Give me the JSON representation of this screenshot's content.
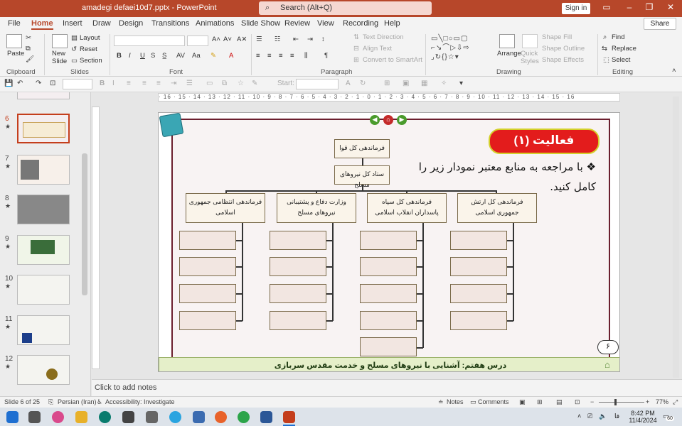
{
  "window": {
    "title": "amadegi defaei10d7.pptx  -  PowerPoint",
    "search_placeholder": "Search (Alt+Q)",
    "signin": "Sign in"
  },
  "menu": {
    "tabs": [
      "File",
      "Home",
      "Insert",
      "Draw",
      "Design",
      "Transitions",
      "Animations",
      "Slide Show",
      "Review",
      "View",
      "Recording",
      "Help"
    ],
    "active": "Home",
    "share": "Share"
  },
  "ribbon": {
    "clipboard": {
      "paste": "Paste",
      "group": "Clipboard"
    },
    "slides": {
      "new_slide": "New Slide",
      "layout": "Layout",
      "reset": "Reset",
      "section": "Section",
      "group": "Slides"
    },
    "font": {
      "group": "Font",
      "bold": "B",
      "italic": "I",
      "underline": "U",
      "strike": "S"
    },
    "paragraph": {
      "text_direction": "Text Direction",
      "align_text": "Align Text",
      "convert": "Convert to SmartArt",
      "group": "Paragraph"
    },
    "drawing": {
      "arrange": "Arrange",
      "quick_styles": "Quick Styles",
      "shape_fill": "Shape Fill",
      "shape_outline": "Shape Outline",
      "shape_effects": "Shape Effects",
      "group": "Drawing"
    },
    "editing": {
      "find": "Find",
      "replace": "Replace",
      "select": "Select",
      "group": "Editing"
    }
  },
  "qat": {
    "start_label": "Start:"
  },
  "thumbnails": [
    {
      "num": "6",
      "selected": true
    },
    {
      "num": "7",
      "selected": false
    },
    {
      "num": "8",
      "selected": false
    },
    {
      "num": "9",
      "selected": false
    },
    {
      "num": "10",
      "selected": false
    },
    {
      "num": "11",
      "selected": false
    },
    {
      "num": "12",
      "selected": false
    }
  ],
  "ruler": {
    "h_ticks": "· 16 · 15 · 14 · 13 · 12 · 11 · 10 · 9 · 8 · 7 · 6 · 5 · 4 · 3 · 2 · 1 · 0 · 1 · 2 · 3 · 4 · 5 · 6 · 7 · 8 · 9 · 10 · 11 · 12 · 13 · 14 · 15 · 16"
  },
  "slide": {
    "activity_title": "فعالیت (۱)",
    "instruction": "❖ با مراجعه به منابع معتبر نمودار زیر را کامل کنید.",
    "top_box": "فرماندهی کل قوا",
    "staff_box": "ستاد کل نیروهای مسلح",
    "branches": [
      "فرماندهی کل ارتش جمهوری اسلامی",
      "فرماندهی کل سپاه پاسداران انقلاب اسلامی",
      "وزارت دفاع و پشتیبانی نیروهای مسلح",
      "فرماندهی انتظامی جمهوری اسلامی"
    ],
    "footer": "درس هفتم: آشنایی با نیروهای مسلح و خدمت مقدس سربازی",
    "page": "۶"
  },
  "notes": {
    "placeholder": "Click to add notes"
  },
  "status": {
    "slide": "Slide 6 of 25",
    "language": "Persian (Iran)",
    "accessibility": "Accessibility: Investigate",
    "notes": "Notes",
    "comments": "Comments",
    "zoom": "77%"
  },
  "taskbar": {
    "time": "8:42 PM",
    "date": "11/4/2024",
    "lang": "فا",
    "badge": "60"
  }
}
